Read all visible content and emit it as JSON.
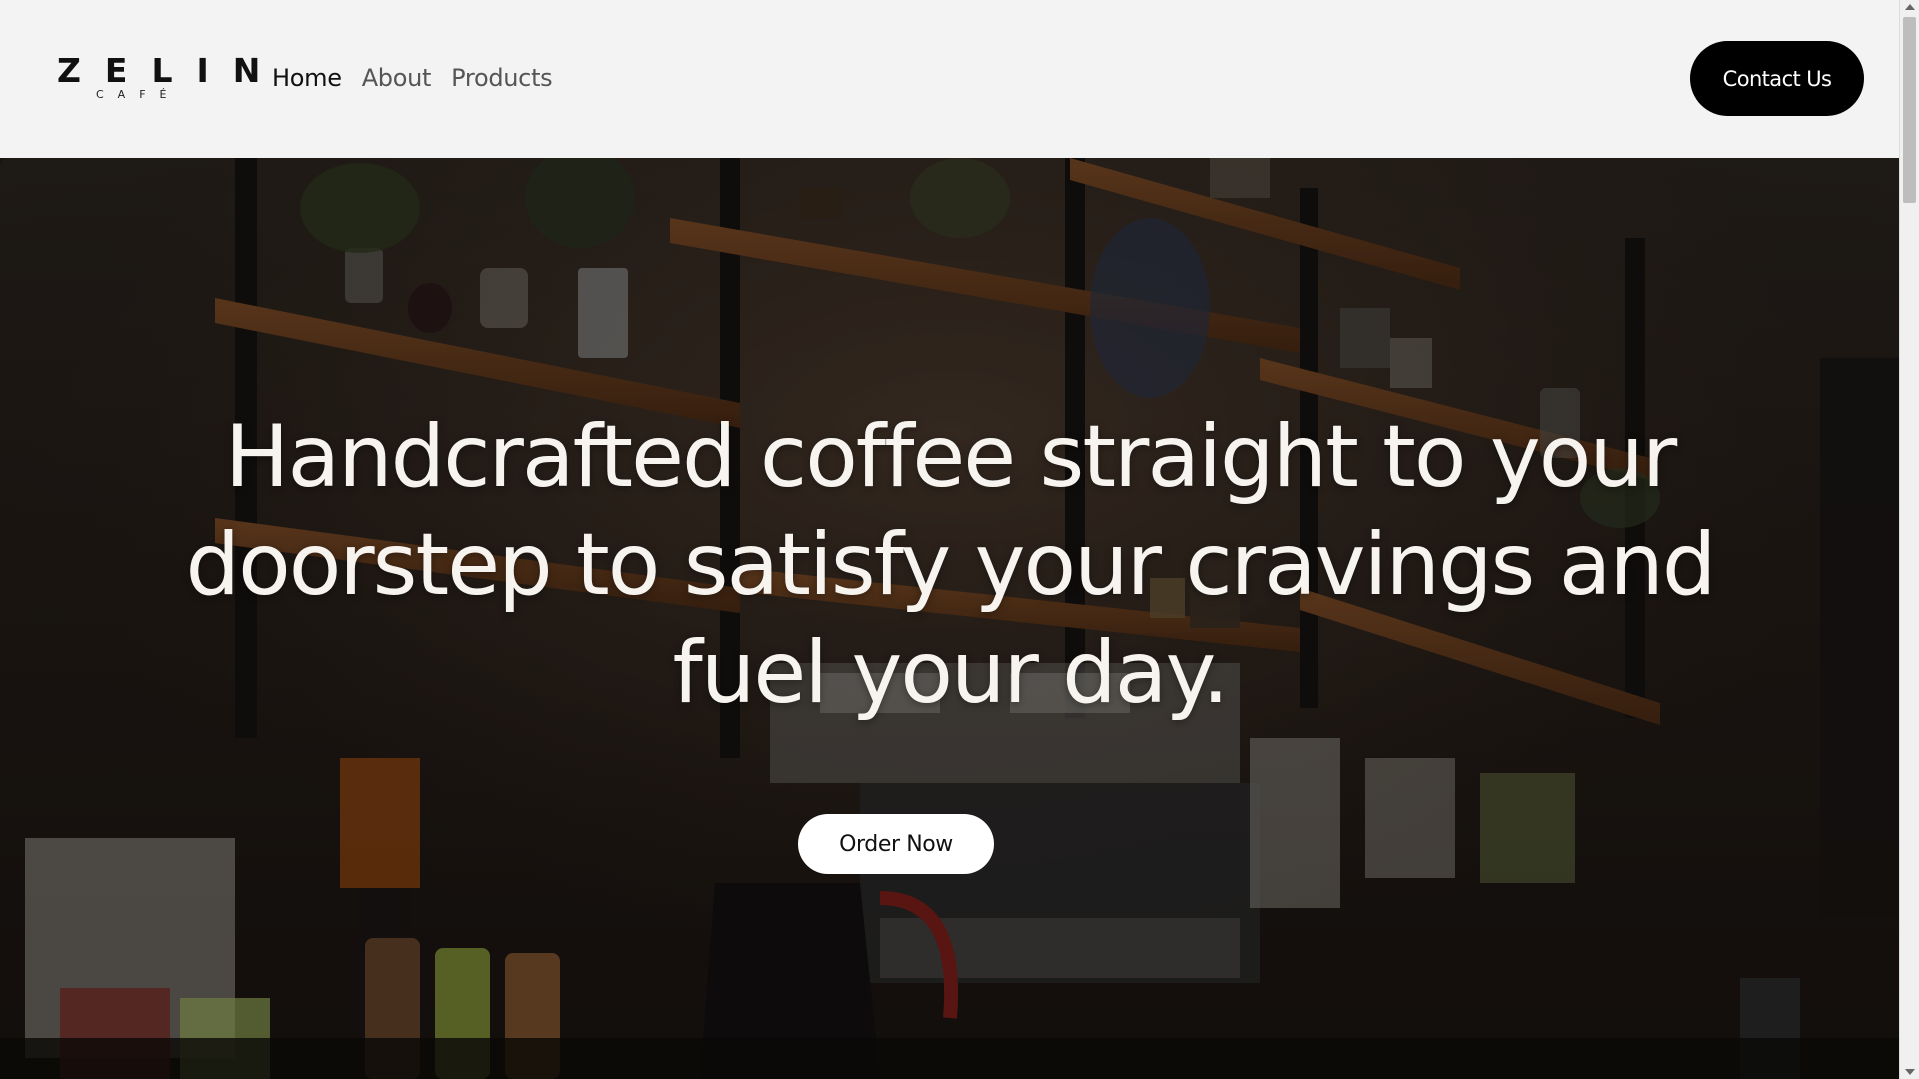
{
  "brand": {
    "name": "ZELIN",
    "tagline": "CAFÉ"
  },
  "nav": {
    "items": [
      {
        "label": "Home",
        "active": true
      },
      {
        "label": "About",
        "active": false
      },
      {
        "label": "Products",
        "active": false
      }
    ],
    "contact_label": "Contact Us"
  },
  "hero": {
    "headline": "Handcrafted coffee straight to your doorstep to satisfy your cravings and fuel your day.",
    "cta_label": "Order Now",
    "background_icon": "cafe-interior-image"
  },
  "colors": {
    "header_bg": "#f3f3f3",
    "primary_button": "#000000",
    "headline_text": "#f7f3ef"
  }
}
